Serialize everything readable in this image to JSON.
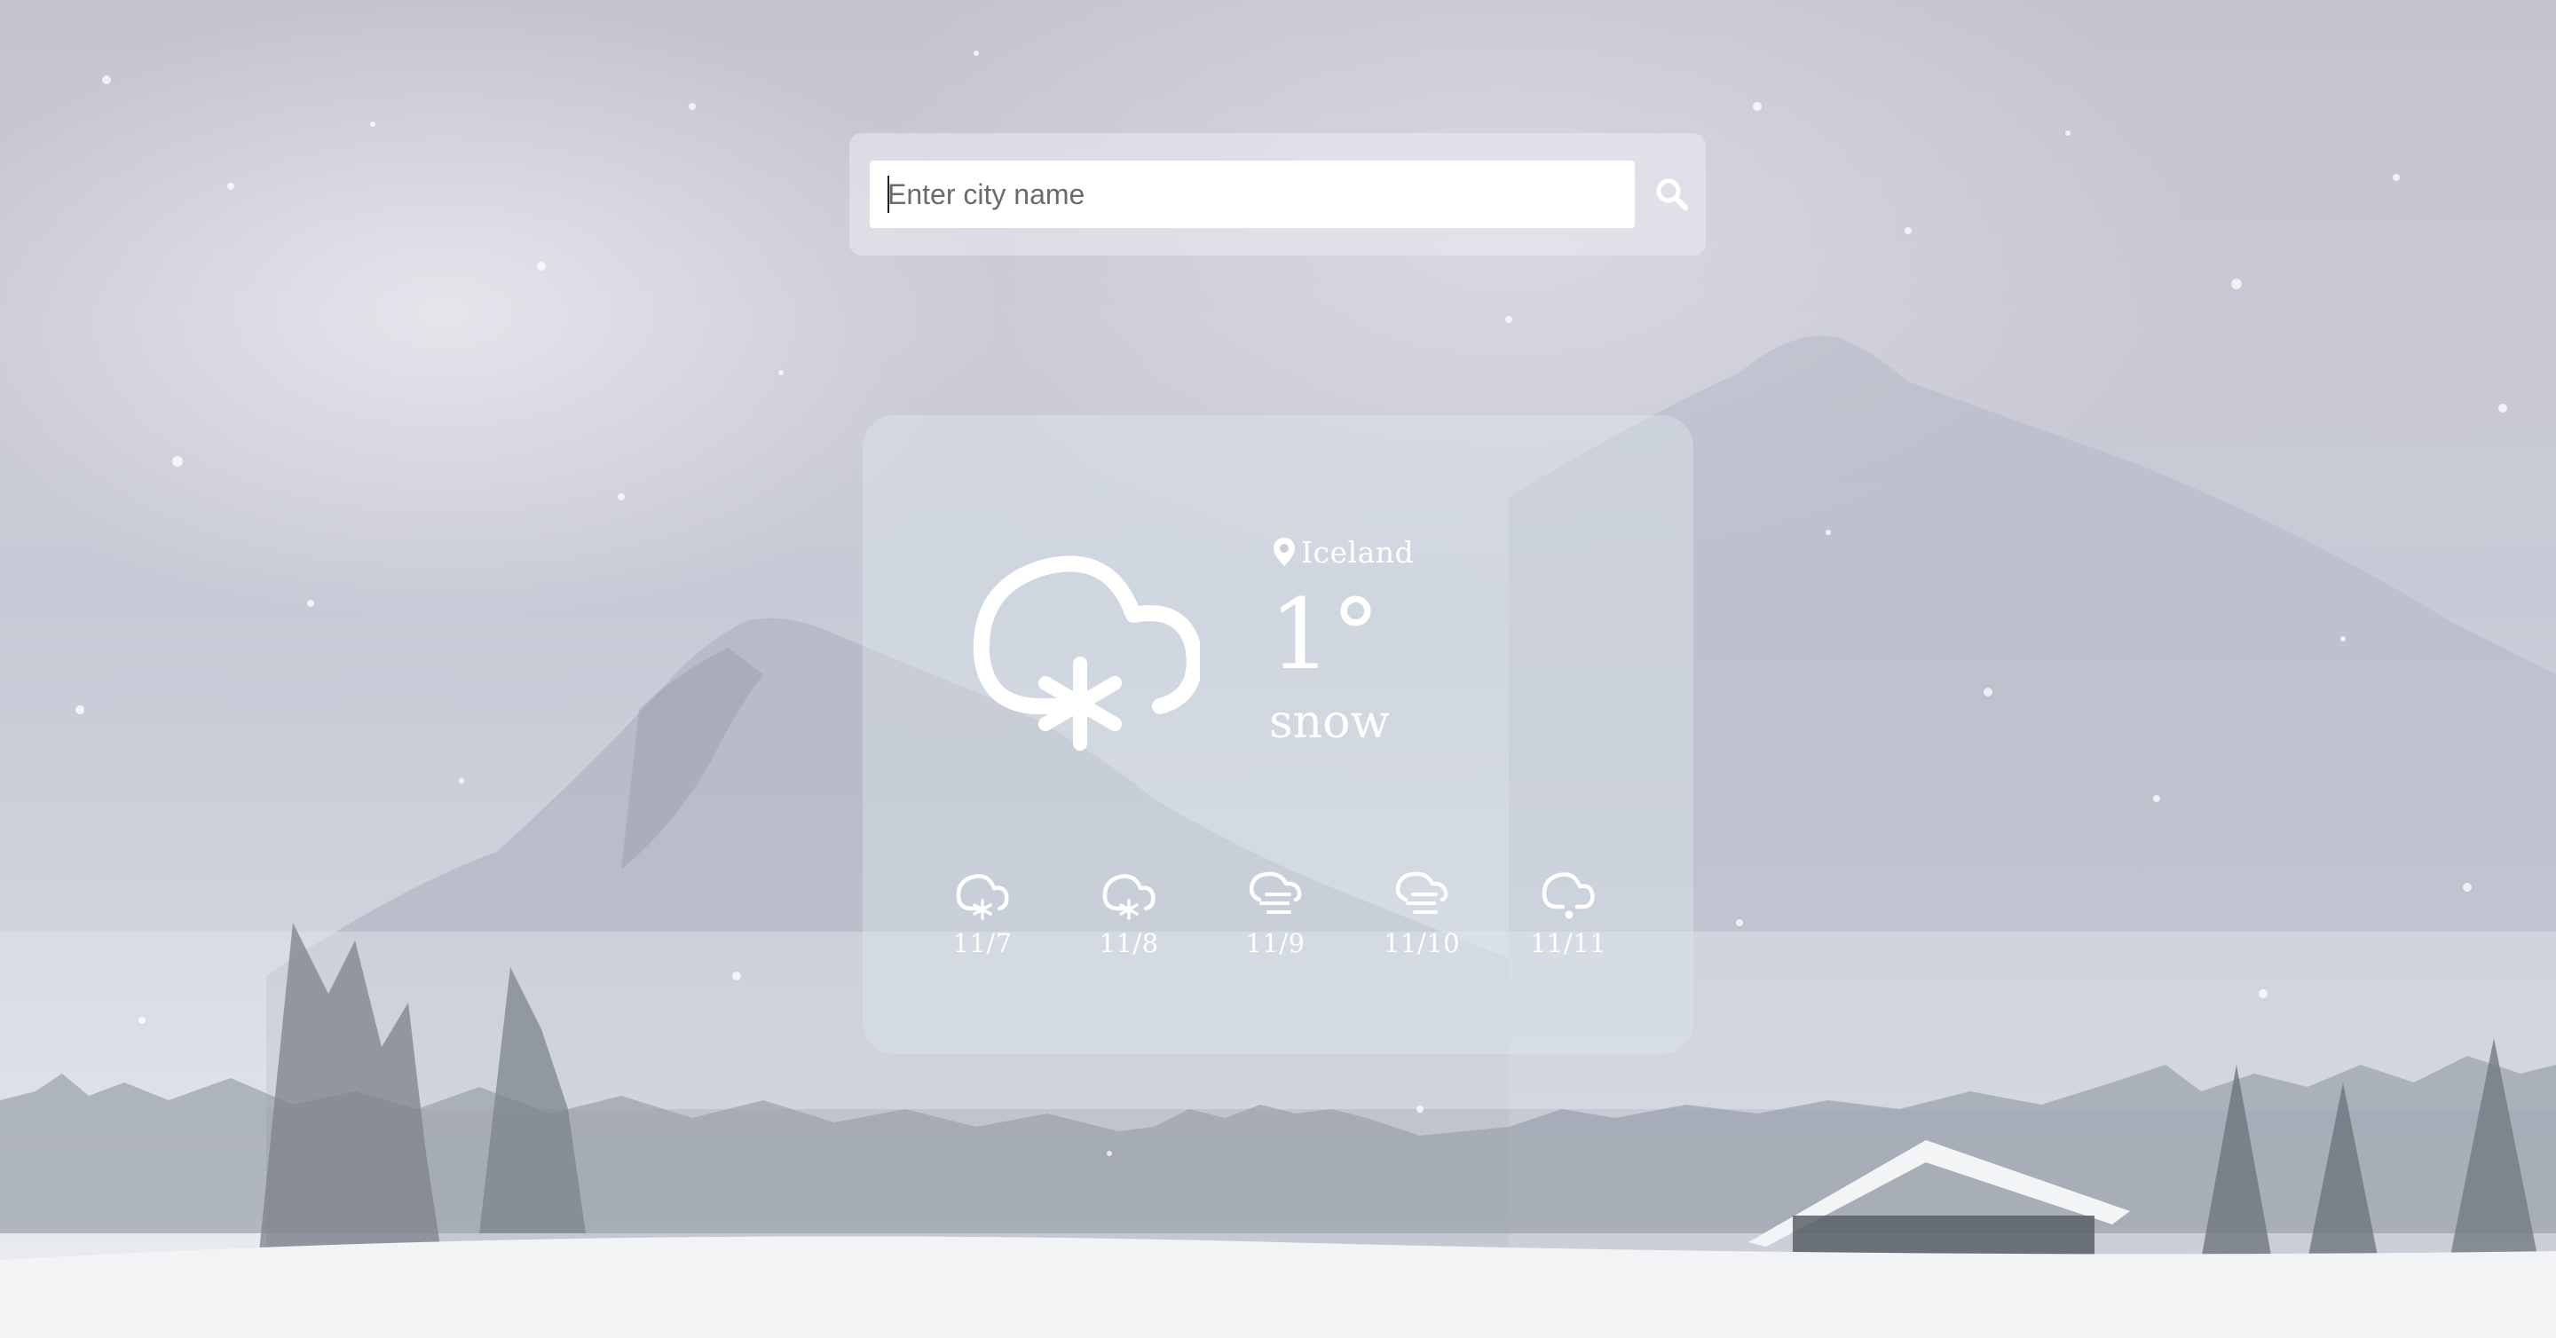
{
  "search": {
    "placeholder": "Enter city name",
    "value": "",
    "button_icon": "search-icon"
  },
  "weather": {
    "location_icon": "map-pin-icon",
    "location": "Iceland",
    "temperature": "1°",
    "condition": "snow",
    "main_icon": "cloud-snow-icon"
  },
  "forecast": [
    {
      "date": "11/7",
      "icon": "cloud-snow-icon"
    },
    {
      "date": "11/8",
      "icon": "cloud-snow-icon"
    },
    {
      "date": "11/9",
      "icon": "cloud-fog-icon"
    },
    {
      "date": "11/10",
      "icon": "cloud-fog-icon"
    },
    {
      "date": "11/11",
      "icon": "cloud-drizzle-icon"
    }
  ],
  "colors": {
    "text": "#ffffff",
    "panel": "#ebebf2",
    "card": "#dee6ec"
  }
}
